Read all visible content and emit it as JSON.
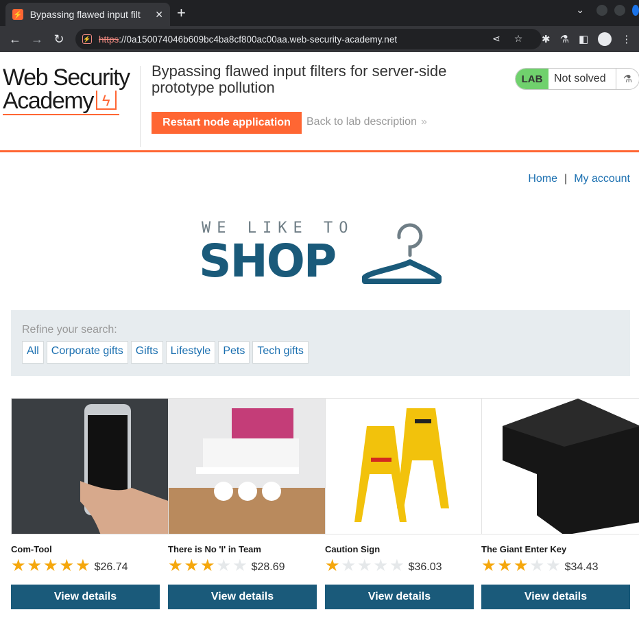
{
  "browser": {
    "tab_title": "Bypassing flawed input filt",
    "tab_icon": "lightning-bolt-icon",
    "url_protocol": "https",
    "url_rest": "://0a150074046b609bc4ba8cf800ac00aa.web-security-academy.net"
  },
  "lab_header": {
    "logo_line1": "Web Security",
    "logo_line2": "Academy",
    "title": "Bypassing flawed input filters for server-side prototype pollution",
    "restart_button": "Restart node application",
    "back_link": "Back to lab description",
    "lab_badge": "LAB",
    "status": "Not solved"
  },
  "nav": {
    "home": "Home",
    "separator": "|",
    "my_account": "My account"
  },
  "shop_logo": {
    "tagline": "WE LIKE TO",
    "word": "SHOP"
  },
  "refine": {
    "label": "Refine your search:",
    "filters": [
      "All",
      "Corporate gifts",
      "Gifts",
      "Lifestyle",
      "Pets",
      "Tech gifts"
    ]
  },
  "products": [
    {
      "name": "Com-Tool",
      "rating": 5,
      "price": "$26.74",
      "button": "View details"
    },
    {
      "name": "There is No 'I' in Team",
      "rating": 3,
      "price": "$28.69",
      "button": "View details"
    },
    {
      "name": "Caution Sign",
      "rating": 1,
      "price": "$36.03",
      "button": "View details"
    },
    {
      "name": "The Giant Enter Key",
      "rating": 3,
      "price": "$34.43",
      "button": "View details"
    }
  ],
  "colors": {
    "accent": "#ff6633",
    "primary": "#1a5a7a",
    "link": "#1a6fb0",
    "star": "#f5a70d",
    "lab_green": "#70d16d"
  }
}
